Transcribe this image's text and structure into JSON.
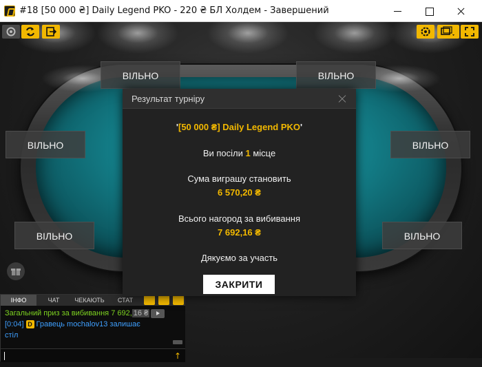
{
  "window": {
    "title": "#18 [50 000 ₴] Daily Legend PKO - 220 ₴ БЛ Холдем - Завершений"
  },
  "seats": [
    {
      "label": "ВІЛЬНО"
    },
    {
      "label": "ВІЛЬНО"
    },
    {
      "label": "ВІЛЬНО"
    },
    {
      "label": "ВІЛЬНО"
    },
    {
      "label": "ВІЛЬНО"
    },
    {
      "label": "ВІЛЬНО"
    }
  ],
  "toolbar": {
    "icons": [
      "settings-icon",
      "swap-icon",
      "exit-icon",
      "gear-icon",
      "layout-icon",
      "fullscreen-icon"
    ],
    "accent": "#f2b800"
  },
  "modal": {
    "title": "Результат турніру",
    "tournament_name_open": "'",
    "tournament_name": "[50 000 ₴] Daily Legend PKO",
    "tournament_name_close": "'",
    "place_prefix": "Ви посіли ",
    "place_value": "1",
    "place_suffix": " місце",
    "winnings_label": "Сума виграшу становить",
    "winnings_value": "6 570,20 ₴",
    "bounty_label": "Всього нагород за вибивання",
    "bounty_value": "7 692,16 ₴",
    "thanks": "Дякуємо за участь",
    "close_button": "ЗАКРИТИ"
  },
  "chat": {
    "tabs": [
      "ІНФО",
      "ЧАТ",
      "ЧЕКАЮТЬ",
      "СТАТ"
    ],
    "active_tab": "ІНФО",
    "messages": {
      "bounty_line": "Загальний приз за вибивання 7 692,",
      "bounty_tail": "16 ₴",
      "time": "[0:04]",
      "badge": "D",
      "player_line_1": "Гравець mochalov13  залишає",
      "player_line_2": "стіл"
    },
    "input_value": ""
  }
}
